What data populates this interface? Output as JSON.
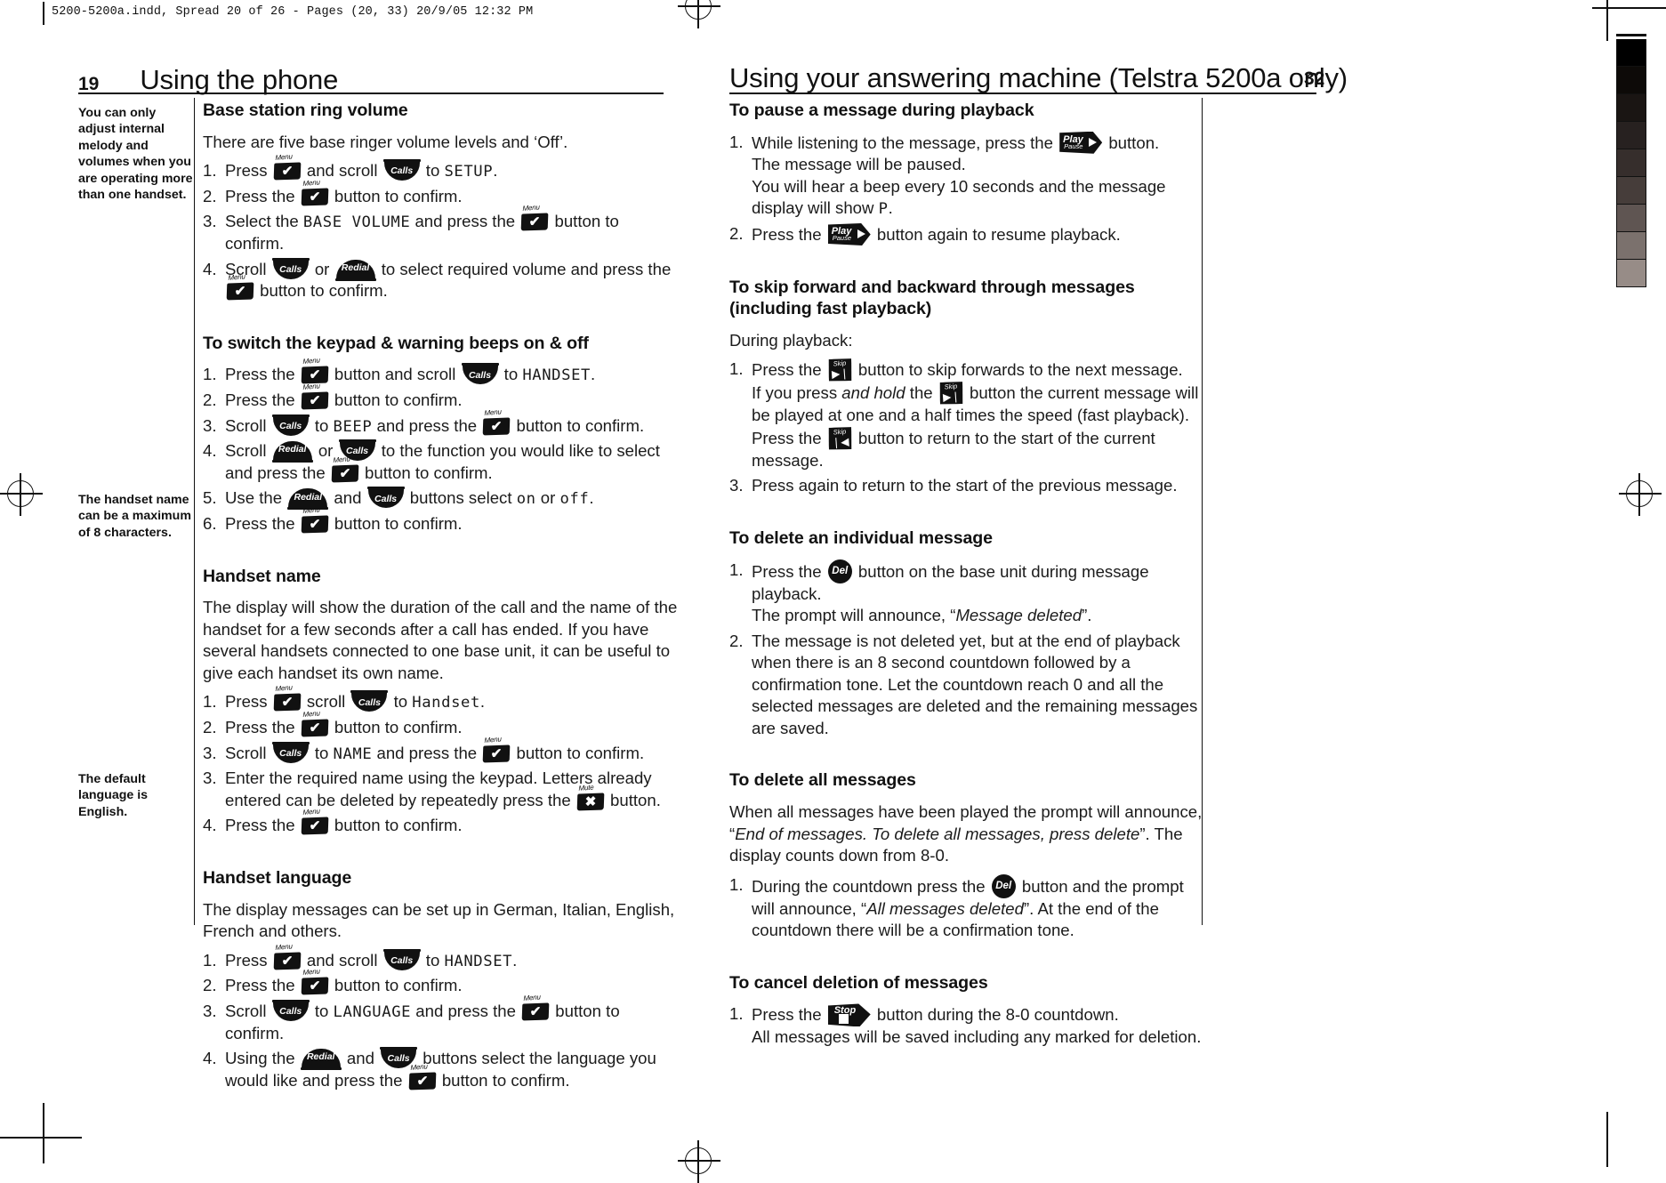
{
  "slug": "5200-5200a.indd, Spread 20 of 26 - Pages (20, 33) 20/9/05 12:32 PM",
  "keys": {
    "menu": {
      "label": "Menu",
      "glyph": "✔"
    },
    "mute": {
      "label": "Mute",
      "glyph": "✖"
    },
    "calls": {
      "label": "Calls"
    },
    "redial": {
      "label": "Redial"
    },
    "play": {
      "line1": "Play",
      "line2": "Pause"
    },
    "skip_fwd": {
      "label": "Skip",
      "glyph": "▶❘"
    },
    "skip_back": {
      "label": "Skip",
      "glyph": "❘◀"
    },
    "del": {
      "label": "Del"
    },
    "stop": {
      "label": "Stop"
    }
  },
  "left_page": {
    "folio": "19",
    "running_head": "Using the phone",
    "margin_notes": [
      "You can only adjust internal melody and volumes when you are operating more than one handset.",
      "The handset name can be a maximum of 8 characters.",
      "The default language is English."
    ],
    "sections": [
      {
        "heading": "Base station ring volume",
        "intro": "There are five base ringer volume levels and ‘Off’.",
        "steps": [
          {
            "num": "1.",
            "parts": [
              "Press ",
              "KEY:menu",
              " and scroll ",
              "KEY:calls",
              " to ",
              "LCD:SETUP",
              "."
            ]
          },
          {
            "num": "2.",
            "parts": [
              "Press the ",
              "KEY:menu",
              " button to confirm."
            ]
          },
          {
            "num": "3.",
            "parts": [
              "Select the ",
              "LCD:BASE  VOLUME",
              " and press the ",
              "KEY:menu",
              " button to confirm."
            ]
          },
          {
            "num": "4.",
            "parts": [
              "Scroll ",
              "KEY:calls",
              " or ",
              "KEY:redial",
              " to select required volume and press the ",
              "KEY:menu",
              " button to confirm."
            ]
          }
        ]
      },
      {
        "heading": "To switch the keypad & warning beeps on & off",
        "steps": [
          {
            "num": "1.",
            "parts": [
              "Press the ",
              "KEY:menu",
              " button and scroll ",
              "KEY:calls",
              " to ",
              "LCD:HANDSET",
              "."
            ]
          },
          {
            "num": "2.",
            "parts": [
              "Press the ",
              "KEY:menu",
              " button to confirm."
            ]
          },
          {
            "num": "3.",
            "parts": [
              "Scroll ",
              "KEY:calls",
              " to ",
              "LCD:BEEP",
              " and press the ",
              "KEY:menu",
              " button to confirm."
            ]
          },
          {
            "num": "4.",
            "parts": [
              "Scroll ",
              "KEY:redial",
              " or ",
              "KEY:calls",
              " to the function you would like to select and press the ",
              "KEY:menu",
              " button to confirm."
            ]
          },
          {
            "num": "5.",
            "parts": [
              "Use the ",
              "KEY:redial",
              " and ",
              "KEY:calls",
              " buttons select ",
              "LCD:on",
              " or ",
              "LCD:off",
              "."
            ]
          },
          {
            "num": "6.",
            "parts": [
              "Press the ",
              "KEY:menu",
              " button to confirm."
            ]
          }
        ]
      },
      {
        "heading": "Handset name",
        "intro": "The display will show the duration of the call and the name of the handset for a few seconds after a call has ended. If you have several handsets connected to one base unit, it can be useful to give each handset its own name.",
        "steps": [
          {
            "num": "1.",
            "parts": [
              "Press ",
              "KEY:menu",
              " scroll ",
              "KEY:calls",
              " to ",
              "LCD:Handset",
              "."
            ]
          },
          {
            "num": "2.",
            "parts": [
              "Press the ",
              "KEY:menu",
              " button to confirm."
            ]
          },
          {
            "num": "3.",
            "parts": [
              "Scroll ",
              "KEY:calls",
              " to ",
              "LCD:NAME",
              " and press the ",
              "KEY:menu",
              " button to confirm."
            ]
          },
          {
            "num": "3.",
            "parts": [
              "Enter the required name using the keypad. Letters already entered can be deleted by repeatedly press the ",
              "KEY:mute",
              " button."
            ]
          },
          {
            "num": "4.",
            "parts": [
              "Press the ",
              "KEY:menu",
              " button to confirm."
            ]
          }
        ]
      },
      {
        "heading": "Handset language",
        "intro": "The display messages can be set up in German, Italian, English, French and others.",
        "steps": [
          {
            "num": "1.",
            "parts": [
              "Press ",
              "KEY:menu",
              " and scroll ",
              "KEY:calls",
              " to ",
              "LCD:HANDSET",
              "."
            ]
          },
          {
            "num": "2.",
            "parts": [
              "Press the ",
              "KEY:menu",
              " button to confirm."
            ]
          },
          {
            "num": "3.",
            "parts": [
              "Scroll ",
              "KEY:calls",
              " to ",
              "LCD:LANGUAGE",
              " and press the ",
              "KEY:menu",
              " button to confirm."
            ]
          },
          {
            "num": "4.",
            "parts": [
              "Using the ",
              "KEY:redial",
              " and ",
              "KEY:calls",
              " buttons select the language you would like and press the ",
              "KEY:menu",
              " button to confirm."
            ]
          }
        ]
      }
    ]
  },
  "right_page": {
    "folio": "32",
    "running_head": "Using your answering machine (Telstra 5200a only)",
    "sections": [
      {
        "heading": "To pause a message during playback",
        "steps": [
          {
            "num": "1.",
            "parts": [
              "While listening to the message, press the ",
              "KEY:play",
              " button."
            ],
            "sublines": [
              [
                "The message will be paused."
              ],
              [
                "You will hear a beep every 10 seconds and the message display will show ",
                "LCD:P",
                "."
              ]
            ]
          },
          {
            "num": "2.",
            "parts": [
              "Press the ",
              "KEY:play",
              " button again to resume playback."
            ]
          }
        ]
      },
      {
        "heading": "To skip forward and backward through messages (including fast playback)",
        "intro": "During playback:",
        "steps": [
          {
            "num": "1.",
            "parts": [
              "Press the ",
              "KEY:skip_fwd",
              " button to skip forwards to the next message."
            ],
            "sublines": [
              [
                "If you press ",
                "EM:and hold",
                " the ",
                "KEY:skip_fwd",
                " button the current message will be played at one and a half times the speed (fast playback)."
              ],
              [
                "Press the ",
                "KEY:skip_back",
                " button to return to the start of the current message."
              ]
            ]
          },
          {
            "num": "3.",
            "parts": [
              "Press again to return to the start of the previous message."
            ]
          }
        ]
      },
      {
        "heading": "To delete an individual message",
        "steps": [
          {
            "num": "1.",
            "parts": [
              "Press the ",
              "KEY:del",
              " button on the base unit during message playback."
            ],
            "sublines": [
              [
                "The prompt will announce, “",
                "EM:Message deleted",
                "”."
              ]
            ]
          },
          {
            "num": "2.",
            "parts": [
              "The message is not deleted yet, but at the end of playback when there is an 8 second countdown followed by a confirmation tone. Let the countdown reach 0 and all the selected messages are deleted and the remaining messages are saved."
            ]
          }
        ]
      },
      {
        "heading": "To delete all messages",
        "paragraphs": [
          [
            "When all messages have been played the prompt will announce, “",
            "EM:End of messages. To delete all messages, press delete",
            "”. The display counts down from 8-0."
          ]
        ],
        "steps": [
          {
            "num": "1.",
            "parts": [
              "During the countdown press the ",
              "KEY:del",
              " button and the prompt will announce, “",
              "EM:All messages deleted",
              "”. At the end of the countdown there will be a confirmation tone."
            ]
          }
        ]
      },
      {
        "heading": "To cancel deletion of messages",
        "steps": [
          {
            "num": "1.",
            "parts": [
              "Press the ",
              "KEY:stop",
              " button during the 8-0 countdown."
            ],
            "sublines": [
              [
                "All messages will be saved including any marked for deletion."
              ]
            ]
          }
        ]
      }
    ]
  },
  "grey_strip": [
    "#000000",
    "#0d0a08",
    "#1a1513",
    "#272120",
    "#362e2c",
    "#463d3a",
    "#5f5552",
    "#7b716d",
    "#978c87",
    "#b3a9a4",
    "#cdc5c0",
    "#e2dcd8"
  ]
}
